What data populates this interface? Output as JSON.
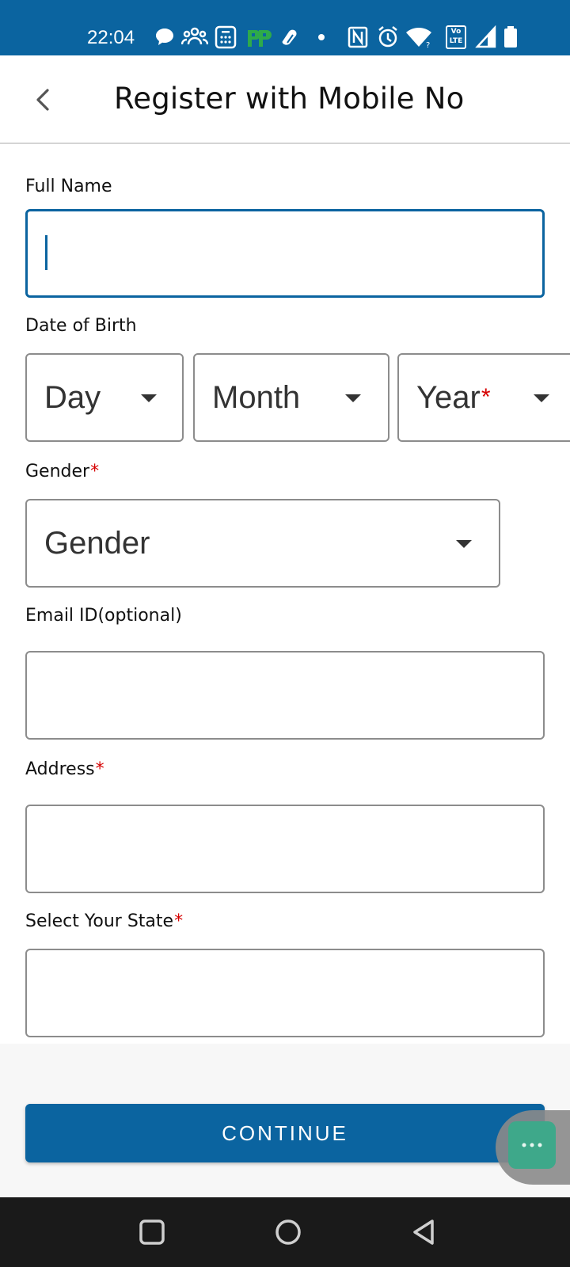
{
  "status_bar": {
    "time": "22:04",
    "icons": [
      "chat-bubble-icon",
      "people-icon",
      "calculator-icon",
      "phonepe-icon",
      "link-icon",
      "dot-icon",
      "nfc-icon",
      "alarm-icon",
      "wifi-icon",
      "volte-icon",
      "signal-icon",
      "battery-icon"
    ],
    "volte_label": "Vo LTE",
    "background": "#0b64a0"
  },
  "header": {
    "title": "Register with Mobile No",
    "back_icon": "chevron-left-icon"
  },
  "form": {
    "full_name": {
      "label": "Full Name",
      "value": ""
    },
    "dob": {
      "label": "Date of Birth",
      "day": "Day",
      "month": "Month",
      "year": "Year",
      "year_required": "*"
    },
    "gender": {
      "label": "Gender",
      "required": "*",
      "value": "Gender"
    },
    "email": {
      "label": "Email ID(optional)",
      "value": ""
    },
    "address": {
      "label": "Address",
      "required": "*",
      "value": ""
    },
    "state": {
      "label": "Select Your State",
      "required": "*",
      "value": ""
    }
  },
  "actions": {
    "continue_label": "CONTINUE"
  },
  "chat": {
    "icon": "chat-dots-icon"
  },
  "nav": {
    "icons": [
      "recents-square-icon",
      "home-circle-icon",
      "back-triangle-icon"
    ]
  },
  "colors": {
    "accent": "#0b64a0",
    "required": "#d60000",
    "chat": "#3ea88a"
  }
}
